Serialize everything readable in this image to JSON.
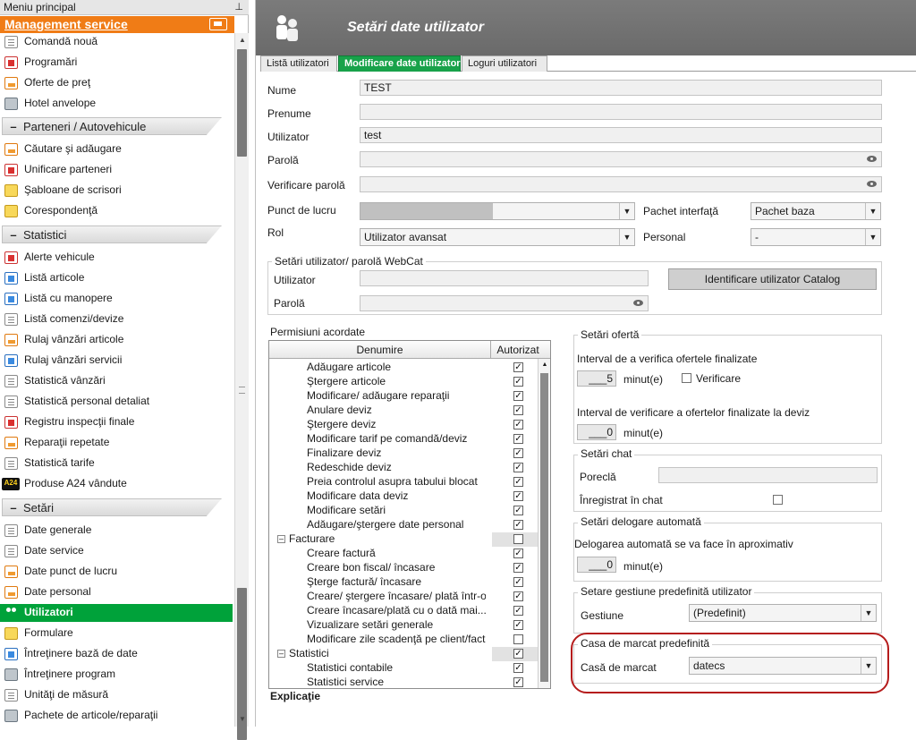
{
  "left_panel": {
    "title": "Meniu principal",
    "pin": "⊥",
    "section_main": "Management service",
    "items_top": [
      {
        "label": "Comandă nouă",
        "icon": "ic-doc"
      },
      {
        "label": "Programări",
        "icon": "ic-red"
      },
      {
        "label": "Oferte de preţ",
        "icon": "ic-orange"
      },
      {
        "label": "Hotel anvelope",
        "icon": "ic-gray"
      }
    ],
    "section_parteneri": "Parteneri / Autovehicule",
    "items_parteneri": [
      {
        "label": "Căutare şi adăugare",
        "icon": "ic-orange"
      },
      {
        "label": "Unificare parteneri",
        "icon": "ic-red"
      },
      {
        "label": "Şabloane de scrisori",
        "icon": "ic-yellow"
      },
      {
        "label": "Corespondenţă",
        "icon": "ic-yellow"
      }
    ],
    "section_statistici": "Statistici",
    "items_statistici": [
      {
        "label": "Alerte vehicule",
        "icon": "ic-red"
      },
      {
        "label": "Listă articole",
        "icon": "ic-blue"
      },
      {
        "label": "Listă cu manopere",
        "icon": "ic-blue"
      },
      {
        "label": "Listă comenzi/devize",
        "icon": "ic-doc"
      },
      {
        "label": "Rulaj vânzări articole",
        "icon": "ic-orange"
      },
      {
        "label": "Rulaj vânzări servicii",
        "icon": "ic-blue"
      },
      {
        "label": "Statistică vânzări",
        "icon": "ic-doc"
      },
      {
        "label": "Statistică personal detaliat",
        "icon": "ic-doc"
      },
      {
        "label": "Registru inspecţii finale",
        "icon": "ic-red"
      },
      {
        "label": "Reparaţii repetate",
        "icon": "ic-orange"
      },
      {
        "label": "Statistică tarife",
        "icon": "ic-doc"
      },
      {
        "label": "Produse A24 vândute",
        "icon": "ic-blackyellow",
        "icon_text": "A24"
      }
    ],
    "section_setari": "Setări",
    "items_setari": [
      {
        "label": "Date generale",
        "icon": "ic-doc"
      },
      {
        "label": "Date service",
        "icon": "ic-doc"
      },
      {
        "label": "Date punct de lucru",
        "icon": "ic-orange"
      },
      {
        "label": "Date personal",
        "icon": "ic-orange"
      },
      {
        "label": "Utilizatori",
        "icon": "ic-people"
      },
      {
        "label": "Formulare",
        "icon": "ic-yellow"
      },
      {
        "label": "Întreţinere bază de date",
        "icon": "ic-blue"
      },
      {
        "label": "Întreţinere program",
        "icon": "ic-gray"
      },
      {
        "label": "Unităţi de măsură",
        "icon": "ic-doc"
      },
      {
        "label": "Pachete de articole/reparaţii",
        "icon": "ic-gray"
      }
    ],
    "collapse_symbol": "–",
    "scroll_up": "▲",
    "scroll_down": "▼"
  },
  "header": {
    "title": "Setări date utilizator"
  },
  "tabs": [
    "Listă utilizatori",
    "Modificare date utilizator",
    "Loguri utilizatori"
  ],
  "form": {
    "nume_label": "Nume",
    "nume_value": "TEST",
    "prenume_label": "Prenume",
    "prenume_value": "",
    "utilizator_label": "Utilizator",
    "utilizator_value": "test",
    "parola_label": "Parolă",
    "verificare_label": "Verificare parolă",
    "punct_label": "Punct de lucru",
    "pachet_label": "Pachet interfaţă",
    "pachet_value": "Pachet baza",
    "rol_label": "Rol",
    "rol_value": "Utilizator avansat",
    "personal_label": "Personal",
    "personal_value": "-"
  },
  "webcat": {
    "title": "Setări utilizator/ parolă WebCat",
    "utilizator_label": "Utilizator",
    "parola_label": "Parolă",
    "button": "Identificare utilizator Catalog"
  },
  "permissions": {
    "title": "Permisiuni acordate",
    "col_name": "Denumire",
    "col_auth": "Autorizat",
    "check_mark": "✓",
    "expand_symbol": "–",
    "rows": [
      {
        "label": "Adăugare articole",
        "checked": true
      },
      {
        "label": "Ştergere articole",
        "checked": true
      },
      {
        "label": "Modificare/ adăugare reparaţii",
        "checked": true
      },
      {
        "label": "Anulare deviz",
        "checked": true
      },
      {
        "label": "Ştergere deviz",
        "checked": true
      },
      {
        "label": "Modificare tarif pe comandă/deviz",
        "checked": true
      },
      {
        "label": "Finalizare deviz",
        "checked": true
      },
      {
        "label": "Redeschide deviz",
        "checked": true
      },
      {
        "label": "Preia controlul asupra tabului blocat",
        "checked": true
      },
      {
        "label": "Modificare data deviz",
        "checked": true
      },
      {
        "label": "Modificare setări",
        "checked": true
      },
      {
        "label": "Adăugare/ştergere date personal",
        "checked": true
      },
      {
        "label": "Facturare",
        "checked": false,
        "group": true
      },
      {
        "label": "Creare factură",
        "checked": true
      },
      {
        "label": "Creare bon fiscal/ încasare",
        "checked": true
      },
      {
        "label": "Şterge factură/ încasare",
        "checked": true
      },
      {
        "label": "Creare/ ştergere încasare/ plată într-o...",
        "checked": true
      },
      {
        "label": "Creare încasare/plată cu o dată mai...",
        "checked": true
      },
      {
        "label": "Vizualizare setări generale",
        "checked": true
      },
      {
        "label": "Modificare zile scadenţă pe client/factură",
        "checked": false
      },
      {
        "label": "Statistici",
        "checked": true,
        "group": true
      },
      {
        "label": "Statistici contabile",
        "checked": true
      },
      {
        "label": "Statistici service",
        "checked": true
      }
    ],
    "explicatie": "Explicaţie"
  },
  "oferta": {
    "title": "Setări ofertă",
    "interval_label": "Interval de a verifica ofertele finalizate",
    "interval_value": "5",
    "unit": "minut(e)",
    "verificare_label": "Verificare",
    "interval_deviz_label": "Interval de verificare a ofertelor finalizate la deviz",
    "interval_deviz_value": "0"
  },
  "chat": {
    "title": "Setări chat",
    "porecla_label": "Poreclă",
    "inregistrat_label": "Înregistrat în chat"
  },
  "delegare": {
    "title": "Setări delogare automată",
    "label": "Delogarea automată se va face în aproximativ",
    "value": "0",
    "unit": "minut(e)"
  },
  "gestiune": {
    "title": "Setare gestiune predefinită utilizator",
    "label": "Gestiune",
    "value": "(Predefinit)"
  },
  "casa": {
    "title": "Casa de marcat predefinită",
    "label": "Casă de marcat",
    "value": "datecs"
  },
  "colors": {
    "accent_orange": "#f07c16",
    "tab_green": "#18a24a",
    "selected_green": "#00a23a",
    "highlight_red": "#b51c1c"
  }
}
